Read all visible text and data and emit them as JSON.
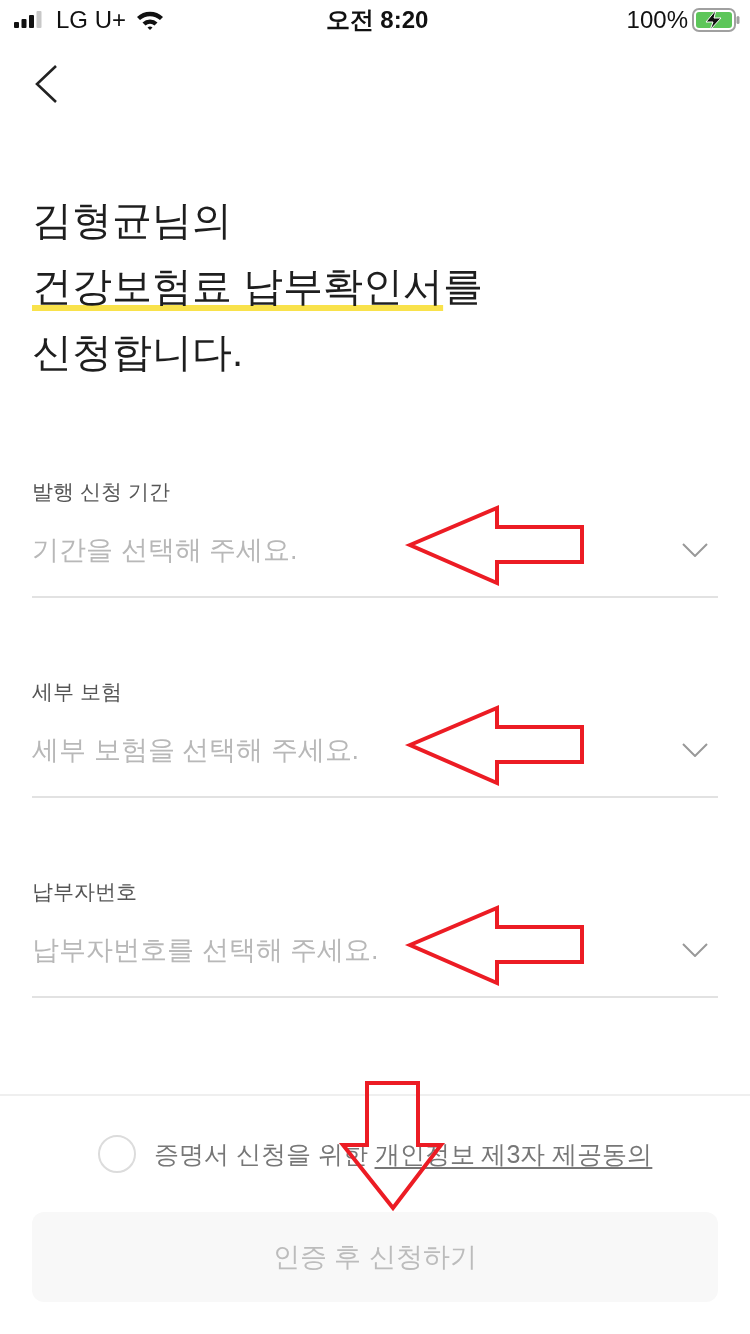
{
  "status_bar": {
    "carrier": "LG U+",
    "time": "오전 8:20",
    "battery": "100%",
    "charging": true
  },
  "title": {
    "parts": [
      {
        "text": "김형균님의\n",
        "highlighted": false
      },
      {
        "text": "건강보험료 납부확인서",
        "highlighted": true
      },
      {
        "text": "를\n신청합니다.",
        "highlighted": false
      }
    ]
  },
  "fields": [
    {
      "label": "발행 신청 기간",
      "placeholder": "기간을 선택해 주세요.",
      "arrow_annotation": true
    },
    {
      "label": "세부 보험",
      "placeholder": "세부 보험을 선택해 주세요.",
      "arrow_annotation": true
    },
    {
      "label": "납부자번호",
      "placeholder": "납부자번호를 선택해 주세요.",
      "arrow_annotation": true
    }
  ],
  "consent": {
    "checked": false,
    "text": "증명서 신청을 위한",
    "link": "개인정보 제3자 제공동의",
    "arrow_annotation": true
  },
  "submit": {
    "label": "인증 후 신청하기",
    "disabled": true
  }
}
